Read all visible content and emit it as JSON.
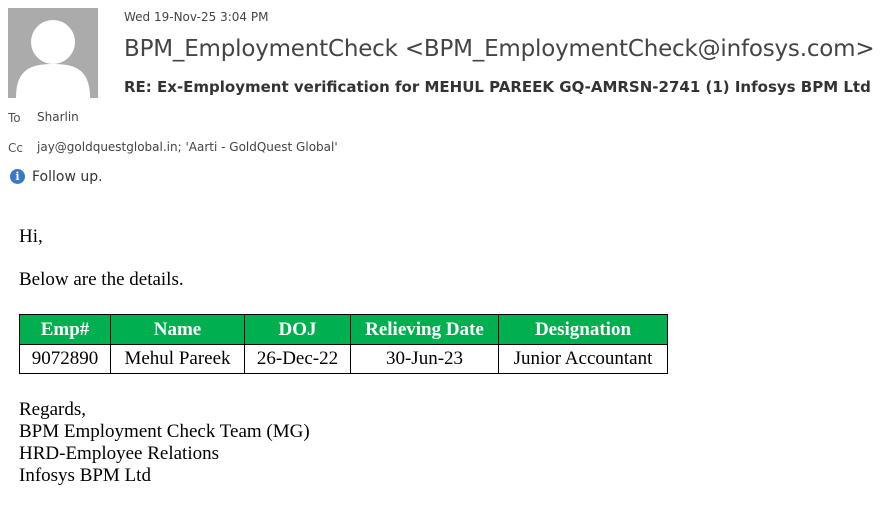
{
  "header": {
    "date": "Wed 19-Nov-25 3:04 PM",
    "sender": "BPM_EmploymentCheck <BPM_EmploymentCheck@infosys.com>",
    "subject": "RE: Ex-Employment verification for MEHUL PAREEK GQ-AMRSN-2741 (1)  Infosys BPM Ltd",
    "to_label": "To",
    "to": "Sharlin",
    "cc_label": "Cc",
    "cc": "jay@goldquestglobal.in; 'Aarti - GoldQuest Global'",
    "flag": "Follow up."
  },
  "body": {
    "greeting": "Hi,",
    "intro": "Below are the details.",
    "table": {
      "headers": [
        "Emp#",
        "Name",
        "DOJ",
        "Relieving Date",
        "Designation"
      ],
      "rows": [
        [
          "9072890",
          "Mehul Pareek",
          "26-Dec-22",
          "30-Jun-23",
          "Junior Accountant"
        ]
      ]
    },
    "signature": [
      "Regards,",
      "BPM Employment Check Team (MG)",
      "HRD-Employee Relations",
      "Infosys BPM Ltd"
    ]
  }
}
